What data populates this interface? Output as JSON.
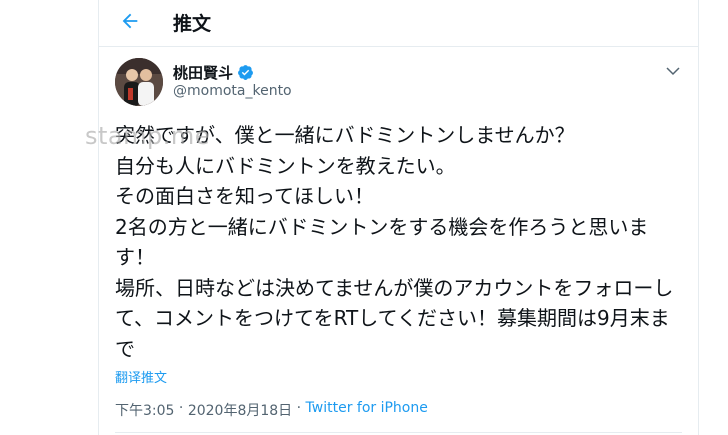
{
  "header": {
    "title": "推文"
  },
  "tweet": {
    "display_name": "桃田賢斗",
    "handle": "@momota_kento",
    "text": "突然ですが、僕と一緒にバドミントンしませんか？\n自分も人にバドミントンを教えたい。\nその面白さを知ってほしい！\n2名の方と一緒にバドミントンをする機会を作ろうと思います！\n場所、日時などは決めてませんが僕のアカウントをフォローして、コメントをつけてをRTしてください！募集期間は9月末まで",
    "translate_label": "翻译推文",
    "time": "下午3:05",
    "separator": " · ",
    "date": "2020年8月18日",
    "source": "Twitter for iPhone"
  },
  "watermark": "stamp.me",
  "colors": {
    "accent": "#1d9bf0",
    "text": "#0f1419",
    "secondary": "#536471",
    "border": "#e6ecf0"
  },
  "icons": {
    "back": "arrow-left-icon",
    "verified": "verified-badge-icon",
    "more": "chevron-down-icon"
  }
}
